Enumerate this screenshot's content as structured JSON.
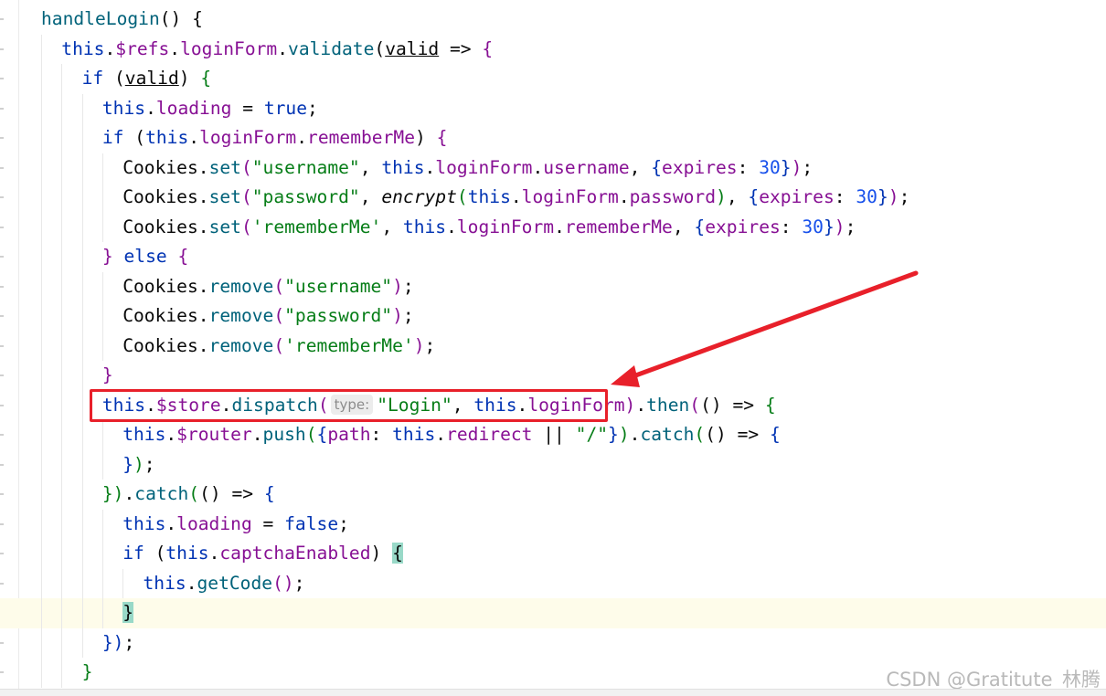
{
  "editor": {
    "lines": [
      {
        "indent": 0,
        "tokens": [
          {
            "t": "handleLogin",
            "c": "fn"
          },
          {
            "t": "() {",
            "c": "paren"
          }
        ]
      },
      {
        "indent": 1,
        "tokens": [
          {
            "t": "this",
            "c": "kw"
          },
          {
            "t": ".",
            "c": "paren"
          },
          {
            "t": "$refs",
            "c": "prop"
          },
          {
            "t": ".",
            "c": "paren"
          },
          {
            "t": "loginForm",
            "c": "prop"
          },
          {
            "t": ".",
            "c": "paren"
          },
          {
            "t": "validate",
            "c": "method"
          },
          {
            "t": "(",
            "c": "paren"
          },
          {
            "t": "valid",
            "c": "param"
          },
          {
            "t": " => ",
            "c": "paren"
          },
          {
            "t": "{",
            "c": "prop"
          }
        ]
      },
      {
        "indent": 2,
        "tokens": [
          {
            "t": "if",
            "c": "kw"
          },
          {
            "t": " (",
            "c": "paren"
          },
          {
            "t": "valid",
            "c": "param"
          },
          {
            "t": ") ",
            "c": "paren"
          },
          {
            "t": "{",
            "c": "str"
          }
        ]
      },
      {
        "indent": 3,
        "tokens": [
          {
            "t": "this",
            "c": "kw"
          },
          {
            "t": ".",
            "c": "paren"
          },
          {
            "t": "loading",
            "c": "prop"
          },
          {
            "t": " = ",
            "c": "paren"
          },
          {
            "t": "true",
            "c": "kw"
          },
          {
            "t": ";",
            "c": "paren"
          }
        ]
      },
      {
        "indent": 3,
        "tokens": [
          {
            "t": "if",
            "c": "kw"
          },
          {
            "t": " (",
            "c": "paren"
          },
          {
            "t": "this",
            "c": "kw"
          },
          {
            "t": ".",
            "c": "paren"
          },
          {
            "t": "loginForm",
            "c": "prop"
          },
          {
            "t": ".",
            "c": "paren"
          },
          {
            "t": "rememberMe",
            "c": "prop"
          },
          {
            "t": ") ",
            "c": "paren"
          },
          {
            "t": "{",
            "c": "prop"
          }
        ]
      },
      {
        "indent": 4,
        "tokens": [
          {
            "t": "Cookies",
            "c": "paren"
          },
          {
            "t": ".",
            "c": "paren"
          },
          {
            "t": "set",
            "c": "method"
          },
          {
            "t": "(",
            "c": "prop"
          },
          {
            "t": "\"username\"",
            "c": "str"
          },
          {
            "t": ", ",
            "c": "paren"
          },
          {
            "t": "this",
            "c": "kw"
          },
          {
            "t": ".",
            "c": "paren"
          },
          {
            "t": "loginForm",
            "c": "prop"
          },
          {
            "t": ".",
            "c": "paren"
          },
          {
            "t": "username",
            "c": "prop"
          },
          {
            "t": ", ",
            "c": "paren"
          },
          {
            "t": "{",
            "c": "brace"
          },
          {
            "t": "expires",
            "c": "prop"
          },
          {
            "t": ": ",
            "c": "paren"
          },
          {
            "t": "30",
            "c": "num"
          },
          {
            "t": "}",
            "c": "brace"
          },
          {
            "t": ")",
            "c": "prop"
          },
          {
            "t": ";",
            "c": "paren"
          }
        ]
      },
      {
        "indent": 4,
        "tokens": [
          {
            "t": "Cookies",
            "c": "paren"
          },
          {
            "t": ".",
            "c": "paren"
          },
          {
            "t": "set",
            "c": "method"
          },
          {
            "t": "(",
            "c": "prop"
          },
          {
            "t": "\"password\"",
            "c": "str"
          },
          {
            "t": ", ",
            "c": "paren"
          },
          {
            "t": "encrypt",
            "c": "italic"
          },
          {
            "t": "(",
            "c": "str"
          },
          {
            "t": "this",
            "c": "kw"
          },
          {
            "t": ".",
            "c": "paren"
          },
          {
            "t": "loginForm",
            "c": "prop"
          },
          {
            "t": ".",
            "c": "paren"
          },
          {
            "t": "password",
            "c": "prop"
          },
          {
            "t": ")",
            "c": "str"
          },
          {
            "t": ", ",
            "c": "paren"
          },
          {
            "t": "{",
            "c": "brace"
          },
          {
            "t": "expires",
            "c": "prop"
          },
          {
            "t": ": ",
            "c": "paren"
          },
          {
            "t": "30",
            "c": "num"
          },
          {
            "t": "}",
            "c": "brace"
          },
          {
            "t": ")",
            "c": "prop"
          },
          {
            "t": ";",
            "c": "paren"
          }
        ]
      },
      {
        "indent": 4,
        "tokens": [
          {
            "t": "Cookies",
            "c": "paren"
          },
          {
            "t": ".",
            "c": "paren"
          },
          {
            "t": "set",
            "c": "method"
          },
          {
            "t": "(",
            "c": "prop"
          },
          {
            "t": "'rememberMe'",
            "c": "str"
          },
          {
            "t": ", ",
            "c": "paren"
          },
          {
            "t": "this",
            "c": "kw"
          },
          {
            "t": ".",
            "c": "paren"
          },
          {
            "t": "loginForm",
            "c": "prop"
          },
          {
            "t": ".",
            "c": "paren"
          },
          {
            "t": "rememberMe",
            "c": "prop"
          },
          {
            "t": ", ",
            "c": "paren"
          },
          {
            "t": "{",
            "c": "brace"
          },
          {
            "t": "expires",
            "c": "prop"
          },
          {
            "t": ": ",
            "c": "paren"
          },
          {
            "t": "30",
            "c": "num"
          },
          {
            "t": "}",
            "c": "brace"
          },
          {
            "t": ")",
            "c": "prop"
          },
          {
            "t": ";",
            "c": "paren"
          }
        ]
      },
      {
        "indent": 3,
        "tokens": [
          {
            "t": "}",
            "c": "prop"
          },
          {
            "t": " else ",
            "c": "kw"
          },
          {
            "t": "{",
            "c": "prop"
          }
        ]
      },
      {
        "indent": 4,
        "tokens": [
          {
            "t": "Cookies",
            "c": "paren"
          },
          {
            "t": ".",
            "c": "paren"
          },
          {
            "t": "remove",
            "c": "method"
          },
          {
            "t": "(",
            "c": "prop"
          },
          {
            "t": "\"username\"",
            "c": "str"
          },
          {
            "t": ")",
            "c": "prop"
          },
          {
            "t": ";",
            "c": "paren"
          }
        ]
      },
      {
        "indent": 4,
        "tokens": [
          {
            "t": "Cookies",
            "c": "paren"
          },
          {
            "t": ".",
            "c": "paren"
          },
          {
            "t": "remove",
            "c": "method"
          },
          {
            "t": "(",
            "c": "prop"
          },
          {
            "t": "\"password\"",
            "c": "str"
          },
          {
            "t": ")",
            "c": "prop"
          },
          {
            "t": ";",
            "c": "paren"
          }
        ]
      },
      {
        "indent": 4,
        "tokens": [
          {
            "t": "Cookies",
            "c": "paren"
          },
          {
            "t": ".",
            "c": "paren"
          },
          {
            "t": "remove",
            "c": "method"
          },
          {
            "t": "(",
            "c": "prop"
          },
          {
            "t": "'rememberMe'",
            "c": "str"
          },
          {
            "t": ")",
            "c": "prop"
          },
          {
            "t": ";",
            "c": "paren"
          }
        ]
      },
      {
        "indent": 3,
        "tokens": [
          {
            "t": "}",
            "c": "prop"
          }
        ]
      },
      {
        "indent": 3,
        "tokens": [
          {
            "t": "this",
            "c": "kw"
          },
          {
            "t": ".",
            "c": "paren"
          },
          {
            "t": "$store",
            "c": "prop"
          },
          {
            "t": ".",
            "c": "paren"
          },
          {
            "t": "dispatch",
            "c": "method"
          },
          {
            "t": "(",
            "c": "prop"
          },
          {
            "t": "type:",
            "c": "hint"
          },
          {
            "t": "\"Login\"",
            "c": "str"
          },
          {
            "t": ", ",
            "c": "paren"
          },
          {
            "t": "this",
            "c": "kw"
          },
          {
            "t": ".",
            "c": "paren"
          },
          {
            "t": "loginForm",
            "c": "prop"
          },
          {
            "t": ")",
            "c": "prop"
          },
          {
            "t": ".",
            "c": "paren"
          },
          {
            "t": "then",
            "c": "method"
          },
          {
            "t": "(",
            "c": "prop"
          },
          {
            "t": "() => ",
            "c": "paren"
          },
          {
            "t": "{",
            "c": "str"
          }
        ]
      },
      {
        "indent": 4,
        "tokens": [
          {
            "t": "this",
            "c": "kw"
          },
          {
            "t": ".",
            "c": "paren"
          },
          {
            "t": "$router",
            "c": "prop"
          },
          {
            "t": ".",
            "c": "paren"
          },
          {
            "t": "push",
            "c": "method"
          },
          {
            "t": "(",
            "c": "str"
          },
          {
            "t": "{",
            "c": "brace"
          },
          {
            "t": "path",
            "c": "prop"
          },
          {
            "t": ": ",
            "c": "paren"
          },
          {
            "t": "this",
            "c": "kw"
          },
          {
            "t": ".",
            "c": "paren"
          },
          {
            "t": "redirect",
            "c": "prop"
          },
          {
            "t": " || ",
            "c": "paren"
          },
          {
            "t": "\"/\"",
            "c": "str"
          },
          {
            "t": "}",
            "c": "brace"
          },
          {
            "t": ")",
            "c": "str"
          },
          {
            "t": ".",
            "c": "paren"
          },
          {
            "t": "catch",
            "c": "method"
          },
          {
            "t": "(",
            "c": "str"
          },
          {
            "t": "() => ",
            "c": "paren"
          },
          {
            "t": "{",
            "c": "brace"
          }
        ]
      },
      {
        "indent": 4,
        "tokens": [
          {
            "t": "}",
            "c": "brace"
          },
          {
            "t": ")",
            "c": "str"
          },
          {
            "t": ";",
            "c": "paren"
          }
        ]
      },
      {
        "indent": 3,
        "tokens": [
          {
            "t": "})",
            "c": "str"
          },
          {
            "t": ".",
            "c": "paren"
          },
          {
            "t": "catch",
            "c": "method"
          },
          {
            "t": "(",
            "c": "str"
          },
          {
            "t": "() => ",
            "c": "paren"
          },
          {
            "t": "{",
            "c": "brace"
          }
        ]
      },
      {
        "indent": 4,
        "tokens": [
          {
            "t": "this",
            "c": "kw"
          },
          {
            "t": ".",
            "c": "paren"
          },
          {
            "t": "loading",
            "c": "prop"
          },
          {
            "t": " = ",
            "c": "paren"
          },
          {
            "t": "false",
            "c": "kw"
          },
          {
            "t": ";",
            "c": "paren"
          }
        ]
      },
      {
        "indent": 4,
        "tokens": [
          {
            "t": "if",
            "c": "kw"
          },
          {
            "t": " (",
            "c": "paren"
          },
          {
            "t": "this",
            "c": "kw"
          },
          {
            "t": ".",
            "c": "paren"
          },
          {
            "t": "captchaEnabled",
            "c": "prop"
          },
          {
            "t": ") ",
            "c": "paren"
          },
          {
            "t": "{",
            "c": "match"
          }
        ]
      },
      {
        "indent": 5,
        "tokens": [
          {
            "t": "this",
            "c": "kw"
          },
          {
            "t": ".",
            "c": "paren"
          },
          {
            "t": "getCode",
            "c": "method"
          },
          {
            "t": "()",
            "c": "prop"
          },
          {
            "t": ";",
            "c": "paren"
          }
        ]
      },
      {
        "indent": 4,
        "current": true,
        "tokens": [
          {
            "t": "}",
            "c": "match"
          }
        ]
      },
      {
        "indent": 3,
        "tokens": [
          {
            "t": "})",
            "c": "brace"
          },
          {
            "t": ";",
            "c": "paren"
          }
        ]
      },
      {
        "indent": 2,
        "tokens": [
          {
            "t": "}",
            "c": "str"
          }
        ]
      }
    ]
  },
  "annotation": {
    "box_color": "#e8202a",
    "arrow_color": "#e8202a"
  },
  "watermark": "CSDN @Gratitute_林腾"
}
